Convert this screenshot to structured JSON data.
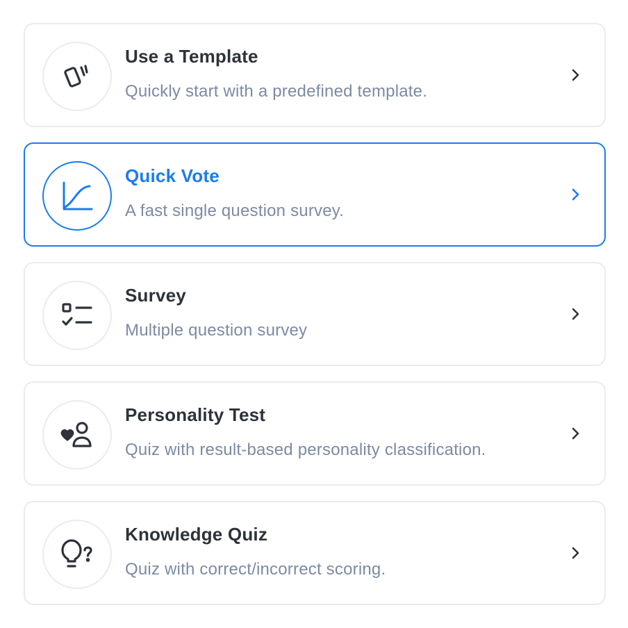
{
  "options": [
    {
      "title": "Use a Template",
      "subtitle": "Quickly start with a predefined template.",
      "icon": "cards-icon"
    },
    {
      "title": "Quick Vote",
      "subtitle": "A fast single question survey.",
      "icon": "growth-chart-icon",
      "selected": true
    },
    {
      "title": "Survey",
      "subtitle": "Multiple question survey",
      "icon": "checklist-icon"
    },
    {
      "title": "Personality Test",
      "subtitle": "Quiz with result-based personality classification.",
      "icon": "heart-person-icon"
    },
    {
      "title": "Knowledge Quiz",
      "subtitle": "Quiz with correct/incorrect scoring.",
      "icon": "lightbulb-question-icon"
    }
  ],
  "colors": {
    "accent": "#1a7cf0",
    "text": "#2e323a",
    "muted": "#7d8aa3",
    "border": "#e9ebef"
  }
}
